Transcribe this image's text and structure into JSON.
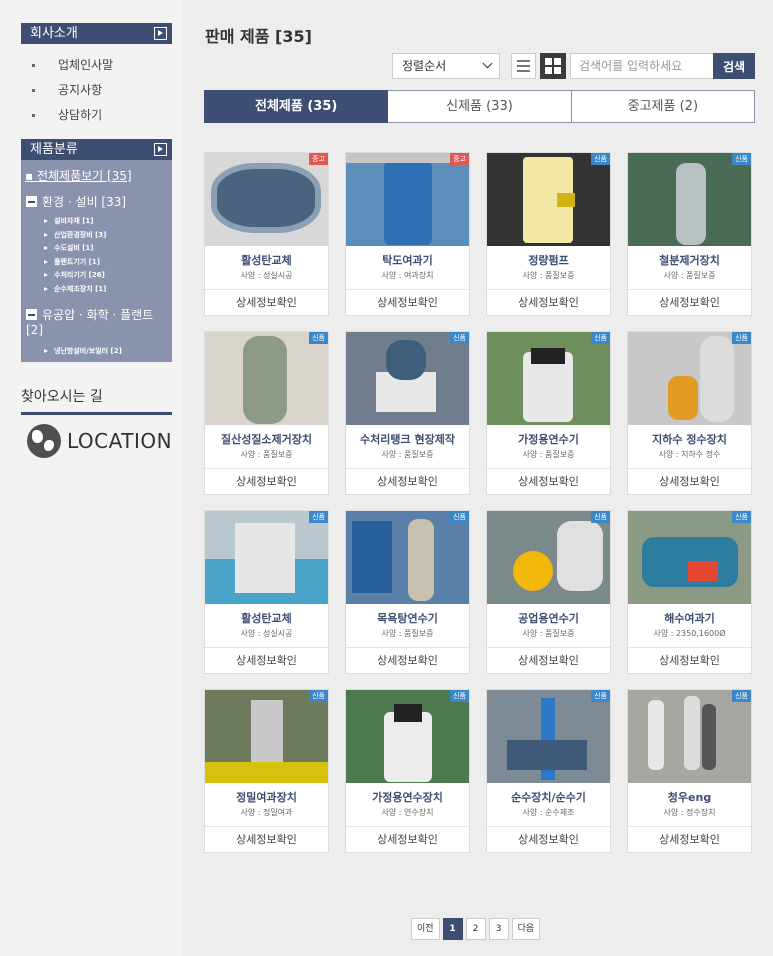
{
  "sidebar": {
    "about_title": "회사소개",
    "about_items": [
      "업체인사말",
      "공지사항",
      "상담하기"
    ],
    "category_title": "제품분류",
    "all_products": "전체제품보기 [35]",
    "groups": [
      {
        "label": "환경 · 설비 [33]",
        "subs": [
          "설비자재 [1]",
          "산업환경장비 [3]",
          "수도설비 [1]",
          "플랜트기기 [1]",
          "수처리기기 [26]",
          "순수제조장치 [1]"
        ]
      },
      {
        "label": "유공압 · 화학 · 플랜트 [2]",
        "subs": [
          "냉난방설비/보일러 [2]"
        ]
      }
    ],
    "directions": "찾아오시는 길",
    "location_label": "LOCATION"
  },
  "main": {
    "title": "판매 제품 [35]",
    "sort_value": "정렬순서",
    "search_placeholder": "검색어를 입력하세요",
    "search_button": "검색",
    "tabs": [
      "전체제품 (35)",
      "신제품 (33)",
      "중고제품 (2)"
    ],
    "detail_label": "상세정보확인",
    "products": [
      {
        "name": "활성탄교체",
        "spec": "사양 : 성실시공",
        "badge": "중고"
      },
      {
        "name": "탁도여과기",
        "spec": "사양 : 여과장치",
        "badge": "중고"
      },
      {
        "name": "정량펌프",
        "spec": "사양 : 품질보증",
        "badge": "신품"
      },
      {
        "name": "철분제거장치",
        "spec": "사양 : 품질보증",
        "badge": "신품"
      },
      {
        "name": "질산성질소제거장치",
        "spec": "사양 : 품질보증",
        "badge": "신품"
      },
      {
        "name": "수처리탱크 현장제작",
        "spec": "사양 : 품질보증",
        "badge": "신품"
      },
      {
        "name": "가정용연수기",
        "spec": "사양 : 품질보증",
        "badge": "신품"
      },
      {
        "name": "지하수 정수장치",
        "spec": "사양 : 지하수 정수",
        "badge": "신품"
      },
      {
        "name": "활성탄교체",
        "spec": "사양 : 성실시공",
        "badge": "신품"
      },
      {
        "name": "목욕탕연수기",
        "spec": "사양 : 품질보증",
        "badge": "신품"
      },
      {
        "name": "공업용연수기",
        "spec": "사양 : 품질보증",
        "badge": "신품"
      },
      {
        "name": "해수여과기",
        "spec": "사양 : 2350,1600Ø",
        "badge": "신품"
      },
      {
        "name": "정밀여과장치",
        "spec": "사양 : 정밀여과",
        "badge": "신품"
      },
      {
        "name": "가정용연수장치",
        "spec": "사양 : 연수장치",
        "badge": "신품"
      },
      {
        "name": "순수장치/순수기",
        "spec": "사양 : 순수제조",
        "badge": "신품"
      },
      {
        "name": "청우eng",
        "spec": "사양 : 정수장치",
        "badge": "신품"
      }
    ],
    "pagination": [
      "이전",
      "1",
      "2",
      "3",
      "다음"
    ],
    "current_page": "1"
  },
  "colors": {
    "navy": "#3e4e73",
    "panel": "#8a93ad",
    "new_badge": "#3a87c9",
    "used_badge": "#e0594f"
  },
  "icons": [
    "chevron-right-box-icon",
    "minus-box-icon",
    "globe-icon",
    "list-view-icon",
    "grid-view-icon",
    "chevron-down-icon"
  ]
}
